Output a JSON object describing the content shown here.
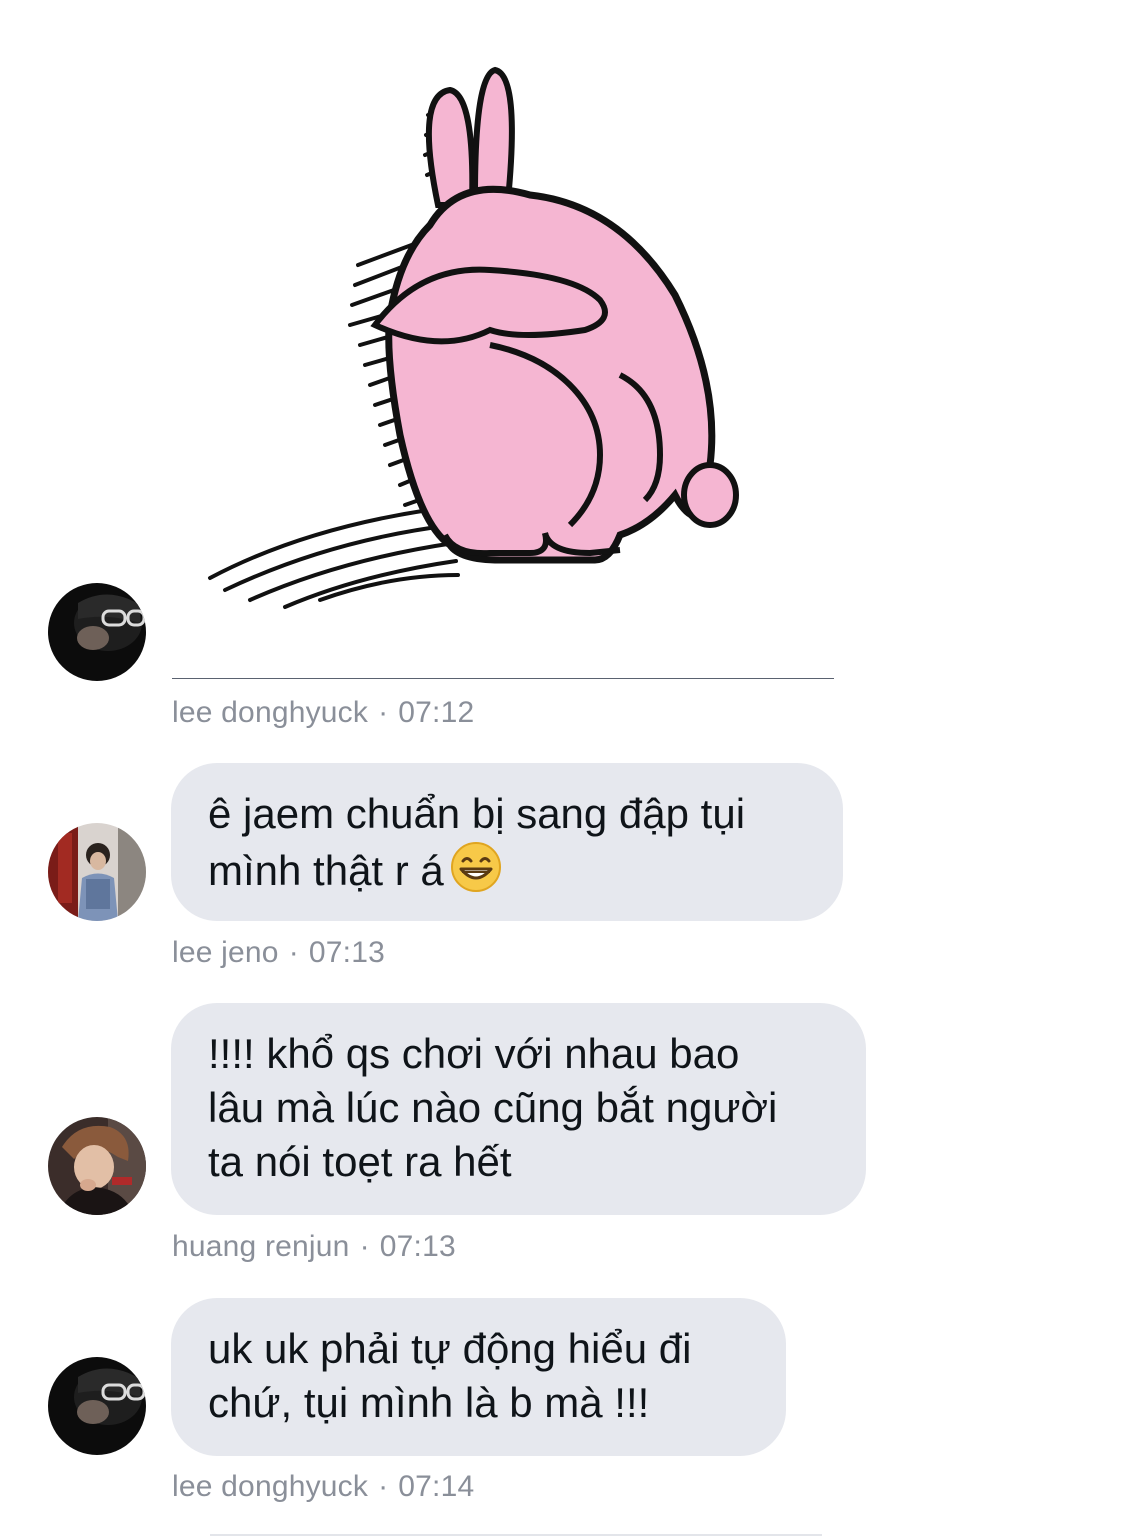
{
  "messages": [
    {
      "type": "sticker",
      "sticker_icon": "pink-rabbit-sticker-icon",
      "sender": "lee donghyuck",
      "separator": "·",
      "time": "07:12"
    },
    {
      "type": "text",
      "lines": [
        "ê jaem chuẩn bị sang đập tụi",
        "mình thật r á"
      ],
      "emoji_icon": "grinning-face-icon",
      "sender": "lee jeno",
      "separator": "·",
      "time": "07:13"
    },
    {
      "type": "text",
      "lines": [
        "!!!! khổ qs chơi với nhau bao",
        "lâu mà lúc nào cũng bắt người",
        "ta nói toẹt ra hết"
      ],
      "sender": "huang renjun",
      "separator": "·",
      "time": "07:13"
    },
    {
      "type": "text",
      "lines": [
        "uk uk phải tự động hiểu đi",
        "chứ, tụi mình là b mà !!!"
      ],
      "sender": "lee donghyuck",
      "separator": "·",
      "time": "07:14"
    }
  ],
  "colors": {
    "bubble_bg": "#e6e8ee",
    "meta_text": "#8a8f99",
    "rabbit_pink": "#f5b6d2",
    "outline": "#111111"
  }
}
